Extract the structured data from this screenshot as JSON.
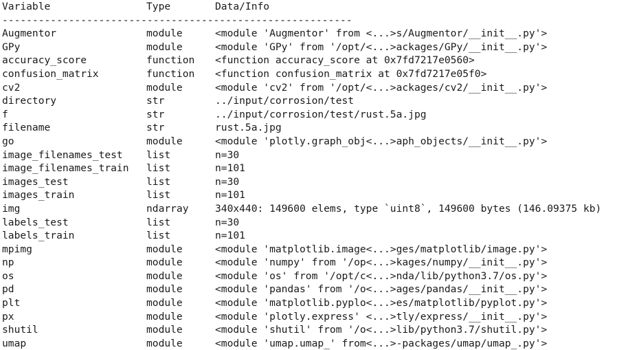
{
  "terminal": {
    "columns": {
      "variable": "Variable",
      "type": "Type",
      "data_info": "Data/Info"
    },
    "separator": "----------------------------------------------------------",
    "rows": [
      {
        "variable": "Augmentor",
        "type": "module",
        "data_info": "<module 'Augmentor' from <...>s/Augmentor/__init__.py'>"
      },
      {
        "variable": "GPy",
        "type": "module",
        "data_info": "<module 'GPy' from '/opt/<...>ackages/GPy/__init__.py'>"
      },
      {
        "variable": "accuracy_score",
        "type": "function",
        "data_info": "<function accuracy_score at 0x7fd7217e0560>"
      },
      {
        "variable": "confusion_matrix",
        "type": "function",
        "data_info": "<function confusion_matrix at 0x7fd7217e05f0>"
      },
      {
        "variable": "cv2",
        "type": "module",
        "data_info": "<module 'cv2' from '/opt/<...>ackages/cv2/__init__.py'>"
      },
      {
        "variable": "directory",
        "type": "str",
        "data_info": "../input/corrosion/test"
      },
      {
        "variable": "f",
        "type": "str",
        "data_info": "../input/corrosion/test/rust.5a.jpg"
      },
      {
        "variable": "filename",
        "type": "str",
        "data_info": "rust.5a.jpg"
      },
      {
        "variable": "go",
        "type": "module",
        "data_info": "<module 'plotly.graph_obj<...>aph_objects/__init__.py'>"
      },
      {
        "variable": "image_filenames_test",
        "type": "list",
        "data_info": "n=30"
      },
      {
        "variable": "image_filenames_train",
        "type": "list",
        "data_info": "n=101"
      },
      {
        "variable": "images_test",
        "type": "list",
        "data_info": "n=30"
      },
      {
        "variable": "images_train",
        "type": "list",
        "data_info": "n=101"
      },
      {
        "variable": "img",
        "type": "ndarray",
        "data_info": "340x440: 149600 elems, type `uint8`, 149600 bytes (146.09375 kb)"
      },
      {
        "variable": "labels_test",
        "type": "list",
        "data_info": "n=30"
      },
      {
        "variable": "labels_train",
        "type": "list",
        "data_info": "n=101"
      },
      {
        "variable": "mpimg",
        "type": "module",
        "data_info": "<module 'matplotlib.image<...>ges/matplotlib/image.py'>"
      },
      {
        "variable": "np",
        "type": "module",
        "data_info": "<module 'numpy' from '/op<...>kages/numpy/__init__.py'>"
      },
      {
        "variable": "os",
        "type": "module",
        "data_info": "<module 'os' from '/opt/c<...>nda/lib/python3.7/os.py'>"
      },
      {
        "variable": "pd",
        "type": "module",
        "data_info": "<module 'pandas' from '/o<...>ages/pandas/__init__.py'>"
      },
      {
        "variable": "plt",
        "type": "module",
        "data_info": "<module 'matplotlib.pyplo<...>es/matplotlib/pyplot.py'>"
      },
      {
        "variable": "px",
        "type": "module",
        "data_info": "<module 'plotly.express' <...>tly/express/__init__.py'>"
      },
      {
        "variable": "shutil",
        "type": "module",
        "data_info": "<module 'shutil' from '/o<...>lib/python3.7/shutil.py'>"
      },
      {
        "variable": "umap",
        "type": "module",
        "data_info": "<module 'umap.umap_' from<...>-packages/umap/umap_.py'>"
      }
    ]
  },
  "colors": {
    "background": "#ffffff",
    "text": "#1a1a1a"
  }
}
